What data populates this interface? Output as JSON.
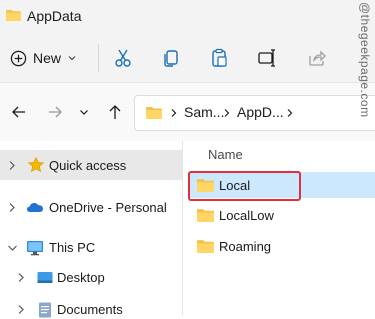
{
  "window": {
    "title": "AppData"
  },
  "command_bar": {
    "new_label": "New",
    "icons": [
      "cut-icon",
      "copy-icon",
      "paste-icon",
      "rename-icon",
      "share-icon"
    ]
  },
  "address_bar": {
    "crumbs": [
      "Sam...",
      "AppD..."
    ]
  },
  "sidebar": {
    "items": [
      {
        "label": "Quick access",
        "icon": "star-icon",
        "selected": true
      },
      {
        "label": "OneDrive - Personal",
        "icon": "cloud-icon"
      },
      {
        "label": "This PC",
        "icon": "monitor-icon",
        "expanded": true
      },
      {
        "label": "Desktop",
        "icon": "desktop-icon"
      },
      {
        "label": "Documents",
        "icon": "documents-icon"
      }
    ]
  },
  "content": {
    "column_header": "Name",
    "files": [
      {
        "name": "Local",
        "selected": true,
        "highlighted": true
      },
      {
        "name": "LocalLow"
      },
      {
        "name": "Roaming"
      }
    ]
  },
  "watermark": "@thegeekpage.com",
  "colors": {
    "folder": "#f4c249",
    "selection": "#cce8ff",
    "highlight_box": "#e0303a",
    "accent": "#0067c0"
  }
}
